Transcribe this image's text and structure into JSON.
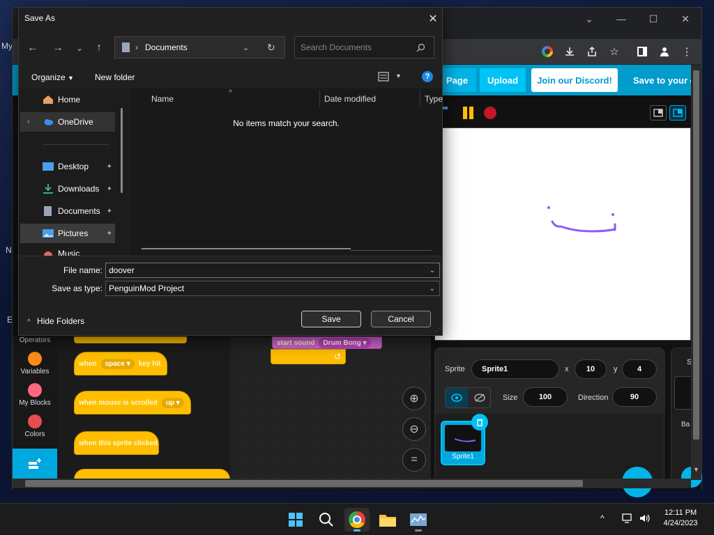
{
  "desktop": {
    "letters": [
      "My",
      "N",
      "E"
    ]
  },
  "chrome": {
    "controls": {
      "chevron": "⌄",
      "minimize": "—",
      "maximize": "☐",
      "close": "✕"
    }
  },
  "penguinmod": {
    "nav": {
      "page": "Page",
      "upload": "Upload",
      "discord": "Join our Discord!",
      "save": "Save to your co"
    },
    "sprite": {
      "label": "Sprite",
      "name": "Sprite1",
      "x_label": "x",
      "x": "10",
      "y_label": "y",
      "y": "4",
      "size_label": "Size",
      "size": "100",
      "direction_label": "Direction",
      "direction": "90",
      "thumb_label": "Sprite1"
    },
    "backdrop": {
      "s": "S",
      "ba": "Ba"
    },
    "categories": [
      {
        "label": "Operators",
        "color": "#59c059"
      },
      {
        "label": "Variables",
        "color": "#ff8c1a"
      },
      {
        "label": "My Blocks",
        "color": "#ff6680"
      },
      {
        "label": "Colors",
        "color": "#e64d4d"
      }
    ],
    "blocks": {
      "when_key": "when",
      "key": "space",
      "key_hit": "key hit",
      "when_scrolled": "when mouse is scrolled",
      "scroll_dir": "up",
      "when_clicked": "when this sprite clicked"
    },
    "workspace": {
      "start_sound": "start sound",
      "sound_name": "Drum Bong"
    }
  },
  "dialog": {
    "title": "Save As",
    "address": "Documents",
    "search_placeholder": "Search Documents",
    "organize": "Organize",
    "new_folder": "New folder",
    "nav": {
      "home": "Home",
      "onedrive": "OneDrive",
      "desktop": "Desktop",
      "downloads": "Downloads",
      "documents": "Documents",
      "pictures": "Pictures",
      "music": "Music"
    },
    "columns": {
      "name": "Name",
      "date_modified": "Date modified",
      "type": "Type"
    },
    "empty_message": "No items match your search.",
    "file_name_label": "File name:",
    "file_name": "doover",
    "save_type_label": "Save as type:",
    "save_type": "PenguinMod Project",
    "hide_folders": "Hide Folders",
    "save": "Save",
    "cancel": "Cancel"
  },
  "taskbar": {
    "time": "12:11 PM",
    "date": "4/24/2023"
  }
}
